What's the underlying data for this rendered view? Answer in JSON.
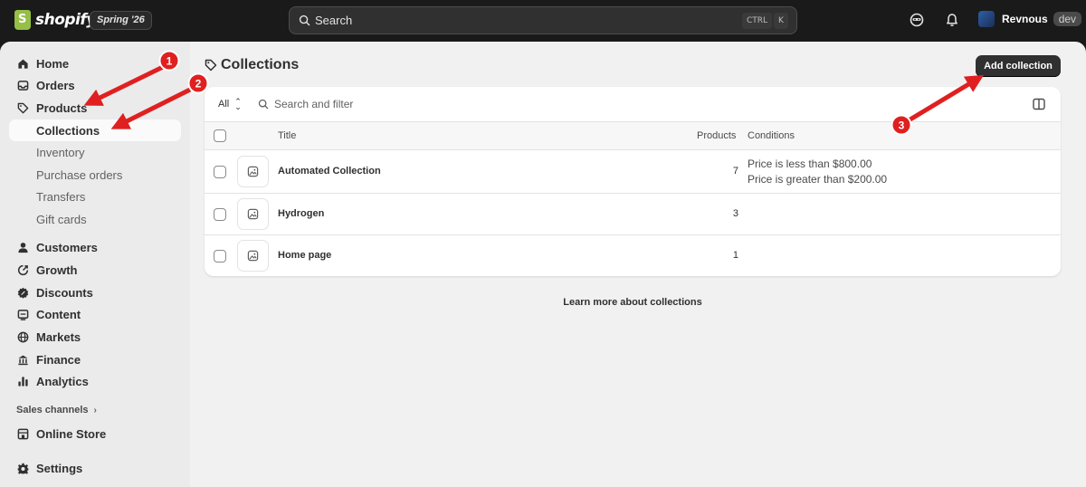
{
  "topbar": {
    "brand": "shopify",
    "edition": "Spring '26",
    "search_placeholder": "Search",
    "shortcut_ctrl": "CTRL",
    "shortcut_key": "K",
    "user_name": "Revnous",
    "user_tag": "dev"
  },
  "sidebar": {
    "home": "Home",
    "orders": "Orders",
    "products": "Products",
    "collections": "Collections",
    "inventory": "Inventory",
    "purchase_orders": "Purchase orders",
    "transfers": "Transfers",
    "gift_cards": "Gift cards",
    "customers": "Customers",
    "growth": "Growth",
    "discounts": "Discounts",
    "content": "Content",
    "markets": "Markets",
    "finance": "Finance",
    "analytics": "Analytics",
    "sales_channels": "Sales channels",
    "online_store": "Online Store",
    "settings": "Settings"
  },
  "page": {
    "title": "Collections",
    "add_button": "Add collection",
    "filter_all": "All",
    "filter_placeholder": "Search and filter",
    "columns": {
      "title": "Title",
      "products": "Products",
      "conditions": "Conditions"
    },
    "rows": [
      {
        "title": "Automated Collection",
        "products": "7",
        "conditions": [
          "Price is less than $800.00",
          "Price is greater than $200.00"
        ]
      },
      {
        "title": "Hydrogen",
        "products": "3",
        "conditions": []
      },
      {
        "title": "Home page",
        "products": "1",
        "conditions": []
      }
    ],
    "learn_more": "Learn more about collections"
  },
  "annotations": {
    "step1": "1",
    "step2": "2",
    "step3": "3",
    "color": "#e02020"
  },
  "colors": {
    "topbar": "#1a1a1a",
    "primary_button": "#303030",
    "brand_green": "#95bf47"
  }
}
